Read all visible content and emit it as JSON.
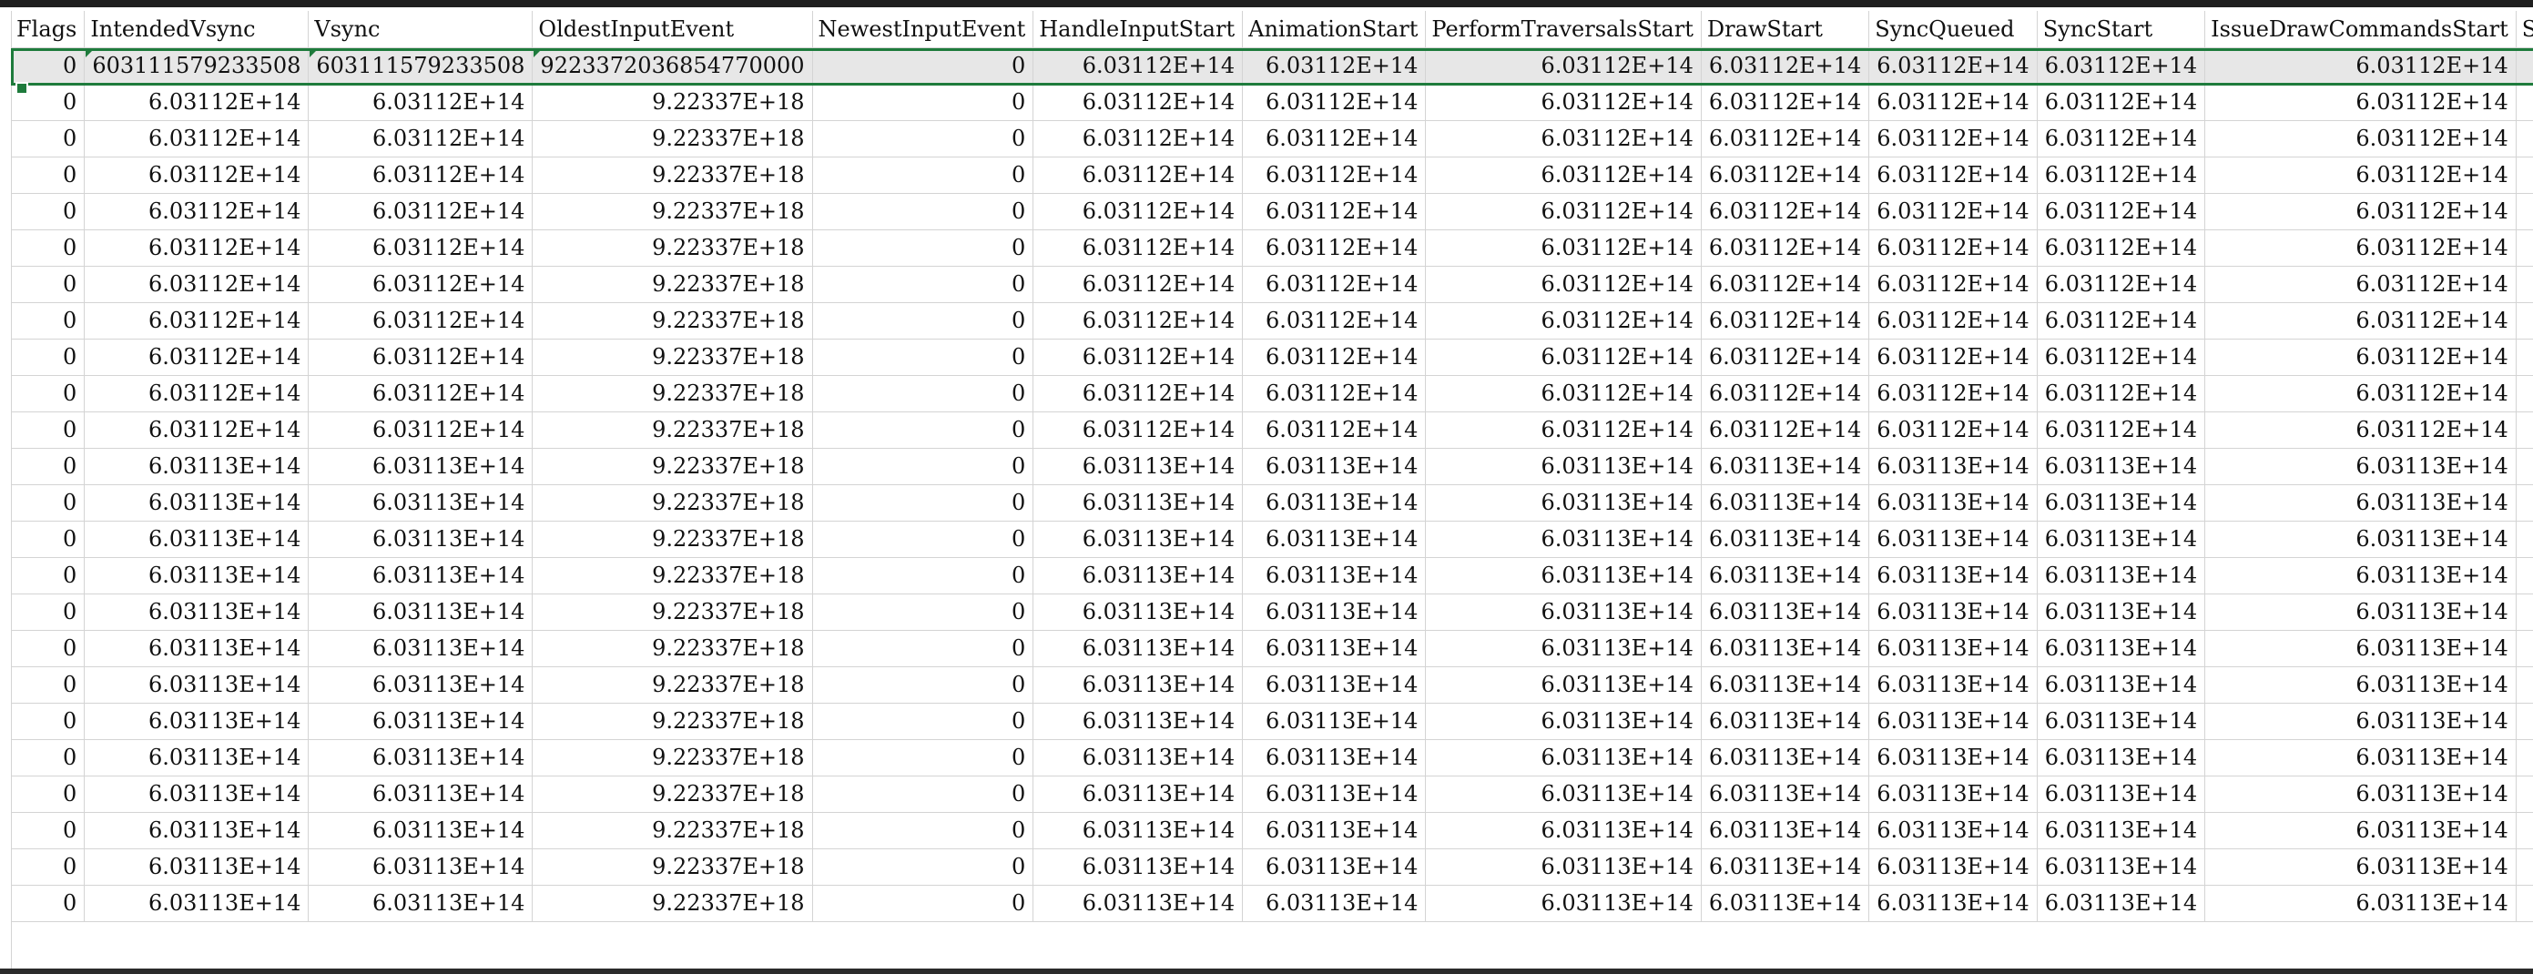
{
  "columns": [
    "Flags",
    "IntendedVsync",
    "Vsync",
    "OldestInputEvent",
    "NewestInputEvent",
    "HandleInputStart",
    "AnimationStart",
    "PerformTraversalsStart",
    "DrawStart",
    "SyncQueued",
    "SyncStart",
    "IssueDrawCommandsStart",
    "S"
  ],
  "selected_row": [
    "0",
    "603111579233508",
    "603111579233508",
    "9223372036854770000",
    "0",
    "6.03112E+14",
    "6.03112E+14",
    "6.03112E+14",
    "6.03112E+14",
    "6.03112E+14",
    "6.03112E+14",
    "6.03112E+14",
    ""
  ],
  "rows": [
    [
      "0",
      "6.03112E+14",
      "6.03112E+14",
      "9.22337E+18",
      "0",
      "6.03112E+14",
      "6.03112E+14",
      "6.03112E+14",
      "6.03112E+14",
      "6.03112E+14",
      "6.03112E+14",
      "6.03112E+14",
      ""
    ],
    [
      "0",
      "6.03112E+14",
      "6.03112E+14",
      "9.22337E+18",
      "0",
      "6.03112E+14",
      "6.03112E+14",
      "6.03112E+14",
      "6.03112E+14",
      "6.03112E+14",
      "6.03112E+14",
      "6.03112E+14",
      ""
    ],
    [
      "0",
      "6.03112E+14",
      "6.03112E+14",
      "9.22337E+18",
      "0",
      "6.03112E+14",
      "6.03112E+14",
      "6.03112E+14",
      "6.03112E+14",
      "6.03112E+14",
      "6.03112E+14",
      "6.03112E+14",
      ""
    ],
    [
      "0",
      "6.03112E+14",
      "6.03112E+14",
      "9.22337E+18",
      "0",
      "6.03112E+14",
      "6.03112E+14",
      "6.03112E+14",
      "6.03112E+14",
      "6.03112E+14",
      "6.03112E+14",
      "6.03112E+14",
      ""
    ],
    [
      "0",
      "6.03112E+14",
      "6.03112E+14",
      "9.22337E+18",
      "0",
      "6.03112E+14",
      "6.03112E+14",
      "6.03112E+14",
      "6.03112E+14",
      "6.03112E+14",
      "6.03112E+14",
      "6.03112E+14",
      ""
    ],
    [
      "0",
      "6.03112E+14",
      "6.03112E+14",
      "9.22337E+18",
      "0",
      "6.03112E+14",
      "6.03112E+14",
      "6.03112E+14",
      "6.03112E+14",
      "6.03112E+14",
      "6.03112E+14",
      "6.03112E+14",
      ""
    ],
    [
      "0",
      "6.03112E+14",
      "6.03112E+14",
      "9.22337E+18",
      "0",
      "6.03112E+14",
      "6.03112E+14",
      "6.03112E+14",
      "6.03112E+14",
      "6.03112E+14",
      "6.03112E+14",
      "6.03112E+14",
      ""
    ],
    [
      "0",
      "6.03112E+14",
      "6.03112E+14",
      "9.22337E+18",
      "0",
      "6.03112E+14",
      "6.03112E+14",
      "6.03112E+14",
      "6.03112E+14",
      "6.03112E+14",
      "6.03112E+14",
      "6.03112E+14",
      ""
    ],
    [
      "0",
      "6.03112E+14",
      "6.03112E+14",
      "9.22337E+18",
      "0",
      "6.03112E+14",
      "6.03112E+14",
      "6.03112E+14",
      "6.03112E+14",
      "6.03112E+14",
      "6.03112E+14",
      "6.03112E+14",
      ""
    ],
    [
      "0",
      "6.03112E+14",
      "6.03112E+14",
      "9.22337E+18",
      "0",
      "6.03112E+14",
      "6.03112E+14",
      "6.03112E+14",
      "6.03112E+14",
      "6.03112E+14",
      "6.03112E+14",
      "6.03112E+14",
      ""
    ],
    [
      "0",
      "6.03113E+14",
      "6.03113E+14",
      "9.22337E+18",
      "0",
      "6.03113E+14",
      "6.03113E+14",
      "6.03113E+14",
      "6.03113E+14",
      "6.03113E+14",
      "6.03113E+14",
      "6.03113E+14",
      ""
    ],
    [
      "0",
      "6.03113E+14",
      "6.03113E+14",
      "9.22337E+18",
      "0",
      "6.03113E+14",
      "6.03113E+14",
      "6.03113E+14",
      "6.03113E+14",
      "6.03113E+14",
      "6.03113E+14",
      "6.03113E+14",
      ""
    ],
    [
      "0",
      "6.03113E+14",
      "6.03113E+14",
      "9.22337E+18",
      "0",
      "6.03113E+14",
      "6.03113E+14",
      "6.03113E+14",
      "6.03113E+14",
      "6.03113E+14",
      "6.03113E+14",
      "6.03113E+14",
      ""
    ],
    [
      "0",
      "6.03113E+14",
      "6.03113E+14",
      "9.22337E+18",
      "0",
      "6.03113E+14",
      "6.03113E+14",
      "6.03113E+14",
      "6.03113E+14",
      "6.03113E+14",
      "6.03113E+14",
      "6.03113E+14",
      ""
    ],
    [
      "0",
      "6.03113E+14",
      "6.03113E+14",
      "9.22337E+18",
      "0",
      "6.03113E+14",
      "6.03113E+14",
      "6.03113E+14",
      "6.03113E+14",
      "6.03113E+14",
      "6.03113E+14",
      "6.03113E+14",
      ""
    ],
    [
      "0",
      "6.03113E+14",
      "6.03113E+14",
      "9.22337E+18",
      "0",
      "6.03113E+14",
      "6.03113E+14",
      "6.03113E+14",
      "6.03113E+14",
      "6.03113E+14",
      "6.03113E+14",
      "6.03113E+14",
      ""
    ],
    [
      "0",
      "6.03113E+14",
      "6.03113E+14",
      "9.22337E+18",
      "0",
      "6.03113E+14",
      "6.03113E+14",
      "6.03113E+14",
      "6.03113E+14",
      "6.03113E+14",
      "6.03113E+14",
      "6.03113E+14",
      ""
    ],
    [
      "0",
      "6.03113E+14",
      "6.03113E+14",
      "9.22337E+18",
      "0",
      "6.03113E+14",
      "6.03113E+14",
      "6.03113E+14",
      "6.03113E+14",
      "6.03113E+14",
      "6.03113E+14",
      "6.03113E+14",
      ""
    ],
    [
      "0",
      "6.03113E+14",
      "6.03113E+14",
      "9.22337E+18",
      "0",
      "6.03113E+14",
      "6.03113E+14",
      "6.03113E+14",
      "6.03113E+14",
      "6.03113E+14",
      "6.03113E+14",
      "6.03113E+14",
      ""
    ],
    [
      "0",
      "6.03113E+14",
      "6.03113E+14",
      "9.22337E+18",
      "0",
      "6.03113E+14",
      "6.03113E+14",
      "6.03113E+14",
      "6.03113E+14",
      "6.03113E+14",
      "6.03113E+14",
      "6.03113E+14",
      ""
    ],
    [
      "0",
      "6.03113E+14",
      "6.03113E+14",
      "9.22337E+18",
      "0",
      "6.03113E+14",
      "6.03113E+14",
      "6.03113E+14",
      "6.03113E+14",
      "6.03113E+14",
      "6.03113E+14",
      "6.03113E+14",
      ""
    ],
    [
      "0",
      "6.03113E+14",
      "6.03113E+14",
      "9.22337E+18",
      "0",
      "6.03113E+14",
      "6.03113E+14",
      "6.03113E+14",
      "6.03113E+14",
      "6.03113E+14",
      "6.03113E+14",
      "6.03113E+14",
      ""
    ],
    [
      "0",
      "6.03113E+14",
      "6.03113E+14",
      "9.22337E+18",
      "0",
      "6.03113E+14",
      "6.03113E+14",
      "6.03113E+14",
      "6.03113E+14",
      "6.03113E+14",
      "6.03113E+14",
      "6.03113E+14",
      ""
    ]
  ],
  "colors": {
    "selection": "#1e7b3c",
    "grid": "#d4d4d4",
    "selected_fill": "#e7e7e7"
  }
}
